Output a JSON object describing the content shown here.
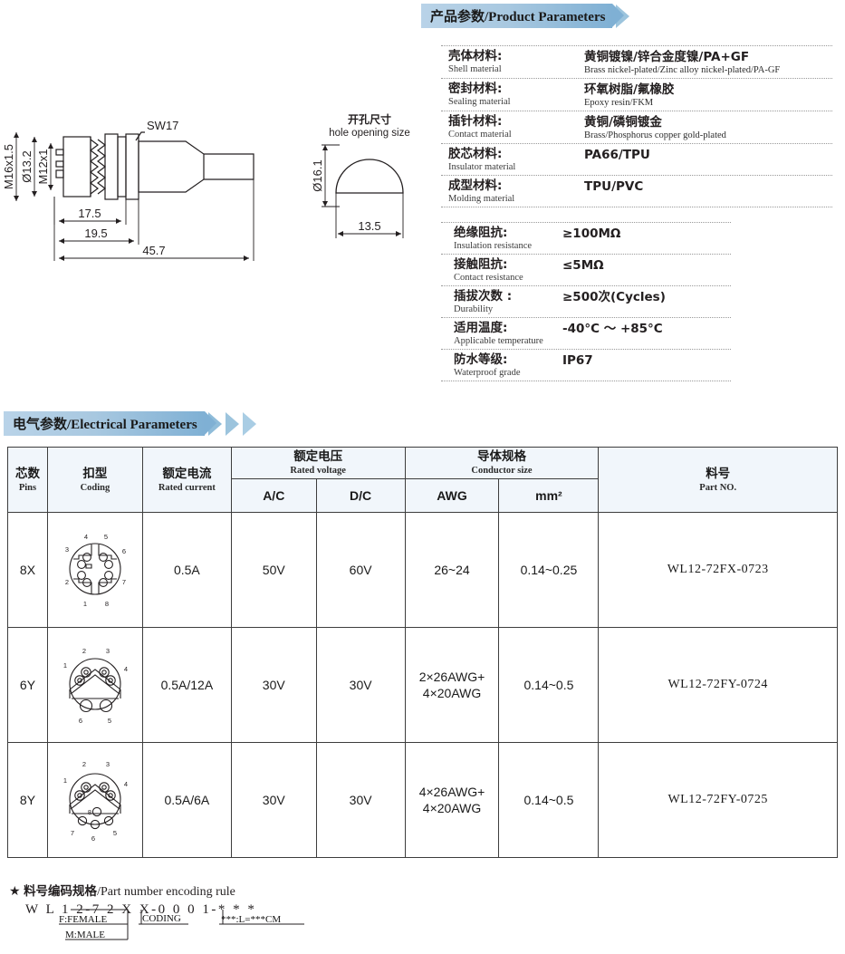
{
  "product_section": {
    "banner_cn": "产品参数",
    "banner_en": "/Product Parameters",
    "materials": [
      {
        "label_cn": "壳体材料:",
        "label_en": "Shell material",
        "value_cn": "黄铜镀镍/锌合金度镍/PA+GF",
        "value_en": "Brass nickel-plated/Zinc alloy nickel-plated/PA-GF"
      },
      {
        "label_cn": "密封材料:",
        "label_en": "Sealing material",
        "value_cn": "环氧树脂/氟橡胶",
        "value_en": "Epoxy resin/FKM"
      },
      {
        "label_cn": "插针材料:",
        "label_en": "Contact material",
        "value_cn": "黄铜/磷铜镀金",
        "value_en": "Brass/Phosphorus copper gold-plated"
      },
      {
        "label_cn": "胶芯材料:",
        "label_en": "Insulator material",
        "value_cn": "PA66/TPU",
        "value_en": ""
      },
      {
        "label_cn": "成型材料:",
        "label_en": "Molding material",
        "value_cn": "TPU/PVC",
        "value_en": ""
      }
    ],
    "specs": [
      {
        "label_cn": "绝缘阻抗:",
        "label_en": "Insulation resistance",
        "value_cn": "≥100MΩ",
        "value_en": ""
      },
      {
        "label_cn": "接触阻抗:",
        "label_en": "Contact resistance",
        "value_cn": "≤5MΩ",
        "value_en": ""
      },
      {
        "label_cn": "插拔次数 :",
        "label_en": "Durability",
        "value_cn": "≥500次(Cycles)",
        "value_en": ""
      },
      {
        "label_cn": "适用温度:",
        "label_en": "Applicable temperature",
        "value_cn": "-40°C ～ +85°C",
        "value_en": ""
      },
      {
        "label_cn": "防水等级:",
        "label_en": "Waterproof grade",
        "value_cn": "IP67",
        "value_en": ""
      }
    ]
  },
  "drawing_main": {
    "thread_outer": "M16x1.5",
    "diameter": "Ø13.2",
    "thread_inner": "M12x1",
    "wrench_flat": "SW17",
    "dim_a": "17.5",
    "dim_b": "19.5",
    "dim_c": "45.7"
  },
  "drawing_hole": {
    "title_cn": "开孔尺寸",
    "title_en": "hole opening size",
    "diameter": "Ø16.1",
    "flat_width": "13.5"
  },
  "electrical_section": {
    "banner_cn": "电气参数",
    "banner_en": "/Electrical Parameters",
    "headers": {
      "pins_cn": "芯数",
      "pins_en": "Pins",
      "coding_cn": "扣型",
      "coding_en": "Coding",
      "current_cn": "额定电流",
      "current_en": "Rated current",
      "voltage_cn": "额定电压",
      "voltage_en": "Rated voltage",
      "ac": "A/C",
      "dc": "D/C",
      "conductor_cn": "导体规格",
      "conductor_en": "Conductor size",
      "awg": "AWG",
      "mm2": "mm²",
      "partno_cn": "料号",
      "partno_en": "Part NO."
    },
    "rows": [
      {
        "pins": "8X",
        "coding_type": "x-coding-8pin",
        "coding_labels": [
          "1",
          "2",
          "3",
          "4",
          "5",
          "6",
          "7",
          "8"
        ],
        "current": "0.5A",
        "ac": "50V",
        "dc": "60V",
        "awg": "26~24",
        "mm2": "0.14~0.25",
        "partno": "WL12-72FX-0723"
      },
      {
        "pins": "6Y",
        "coding_type": "y-coding-6pin",
        "coding_labels": [
          "1",
          "2",
          "3",
          "4",
          "5",
          "6"
        ],
        "current": "0.5A/12A",
        "ac": "30V",
        "dc": "30V",
        "awg": "2×26AWG+\n4×20AWG",
        "awg_line1": "2×26AWG+",
        "awg_line2": "4×20AWG",
        "mm2": "0.14~0.5",
        "partno": "WL12-72FY-0724"
      },
      {
        "pins": "8Y",
        "coding_type": "y-coding-8pin",
        "coding_labels": [
          "1",
          "2",
          "3",
          "4",
          "5",
          "6",
          "7",
          "8"
        ],
        "current": "0.5A/6A",
        "ac": "30V",
        "dc": "30V",
        "awg_line1": "4×26AWG+",
        "awg_line2": "4×20AWG",
        "mm2": "0.14~0.5",
        "partno": "WL12-72FY-0725"
      }
    ]
  },
  "encoding_rule": {
    "star": "★",
    "title_cn": "料号编码规格",
    "title_en": "/Part number encoding rule",
    "code": "W L 1 2-7 2 X X-0 0 0 1-* * *",
    "note_gender_1": "F:FEMALE",
    "note_gender_2": "M:MALE",
    "note_coding": "CODING",
    "note_length": "***:L=***CM"
  },
  "colors": {
    "banner_start": "#b9d3e8",
    "banner_end": "#7fb0d4",
    "chevron": "#8fbcd9",
    "table_header_bg": "#f1f6fb",
    "table_border": "#3d3d3d",
    "text": "#231f20"
  }
}
